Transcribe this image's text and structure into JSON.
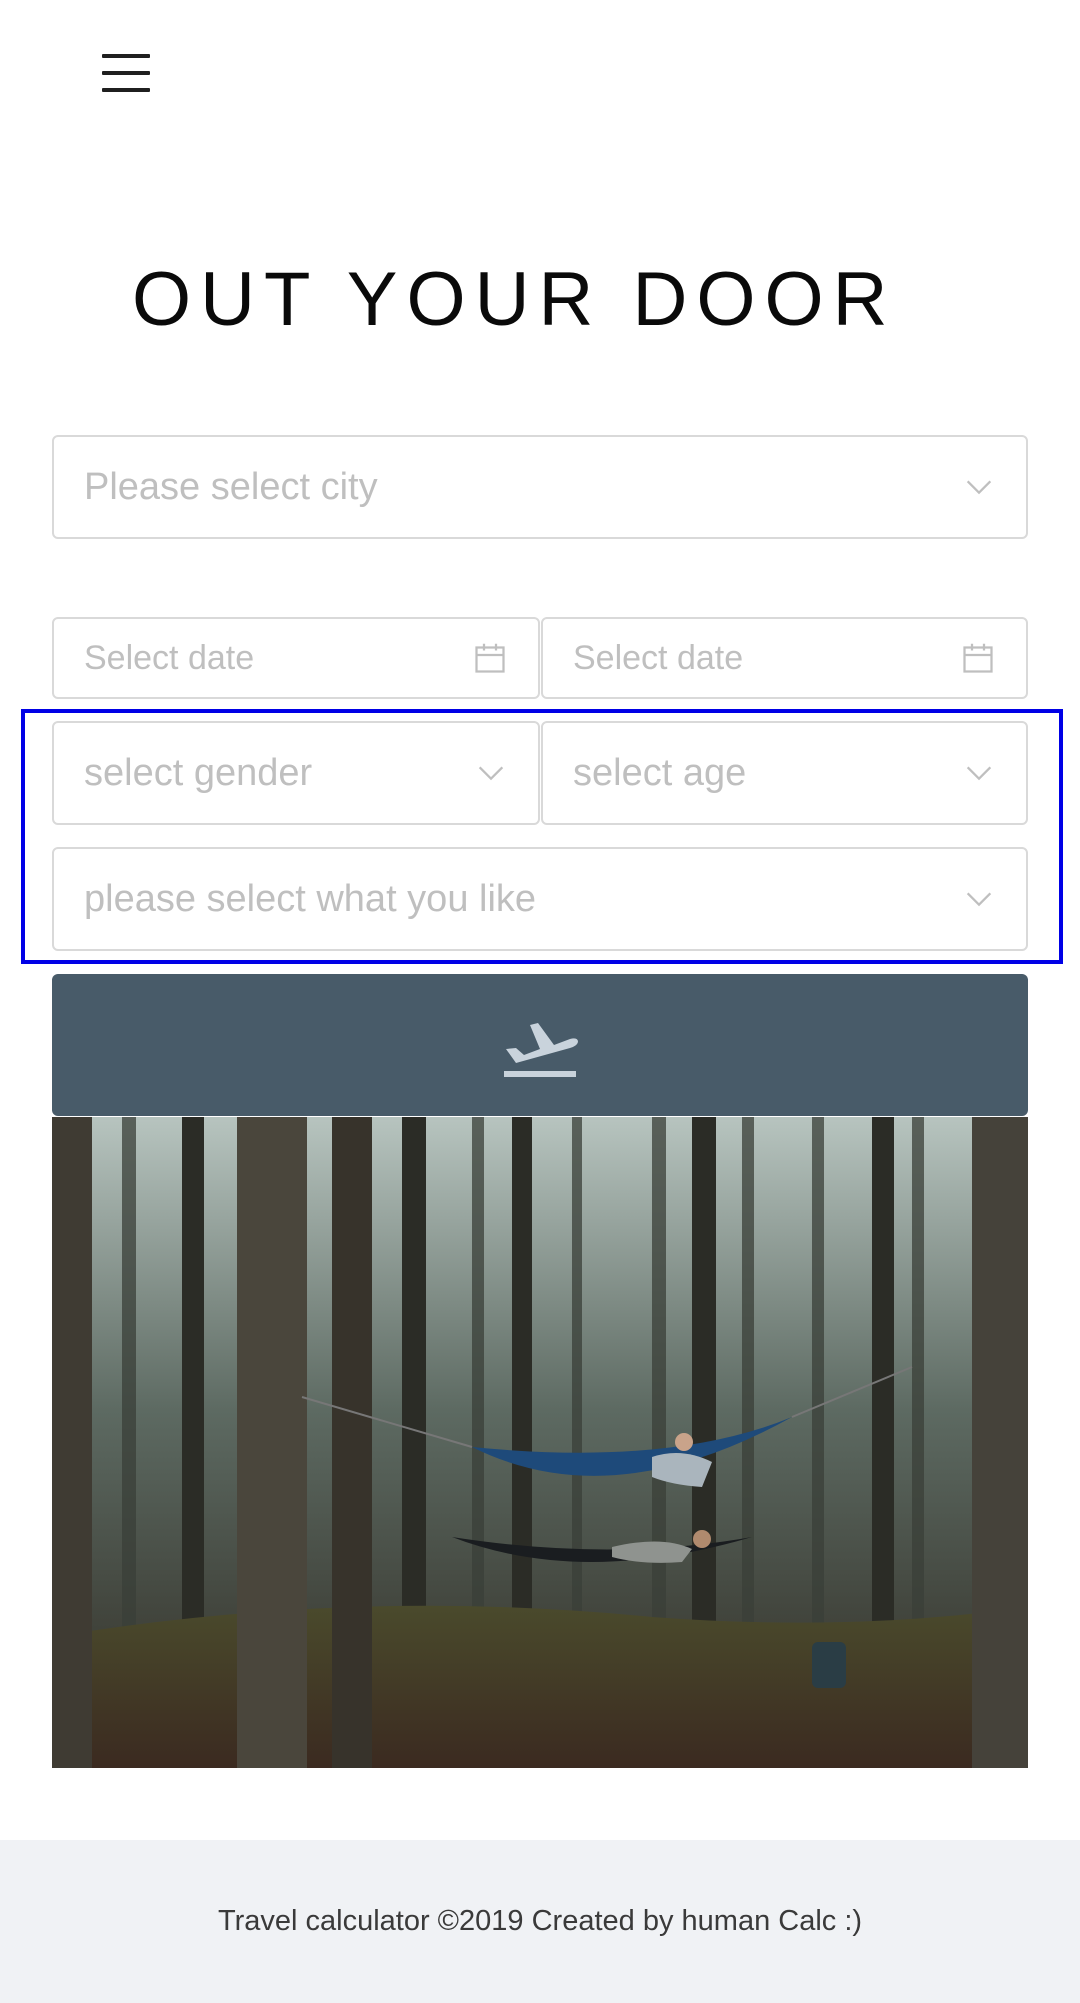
{
  "header": {
    "menu_icon": "hamburger-menu-icon"
  },
  "page": {
    "title": "OUT YOUR DOOR"
  },
  "form": {
    "city": {
      "placeholder": "Please select city",
      "icon": "chevron-down-icon"
    },
    "date_start": {
      "placeholder": "Select date",
      "icon": "calendar-icon"
    },
    "date_end": {
      "placeholder": "Select date",
      "icon": "calendar-icon"
    },
    "gender": {
      "placeholder": "select gender",
      "icon": "chevron-down-icon"
    },
    "age": {
      "placeholder": "select age",
      "icon": "chevron-down-icon"
    },
    "likes": {
      "placeholder": "please select what you like",
      "icon": "chevron-down-icon"
    },
    "submit": {
      "icon": "airplane-takeoff-icon"
    }
  },
  "hero_image": {
    "subject": "two people resting in hammocks in a pine forest"
  },
  "footer": {
    "text": "Travel calculator ©2019 Created by human Calc :)"
  },
  "colors": {
    "submit_button": "#485b69",
    "placeholder_text": "#bfbfbf",
    "field_border": "#d9d9d9",
    "highlight_box": "#0000e6",
    "footer_bg": "#f0f2f5"
  }
}
